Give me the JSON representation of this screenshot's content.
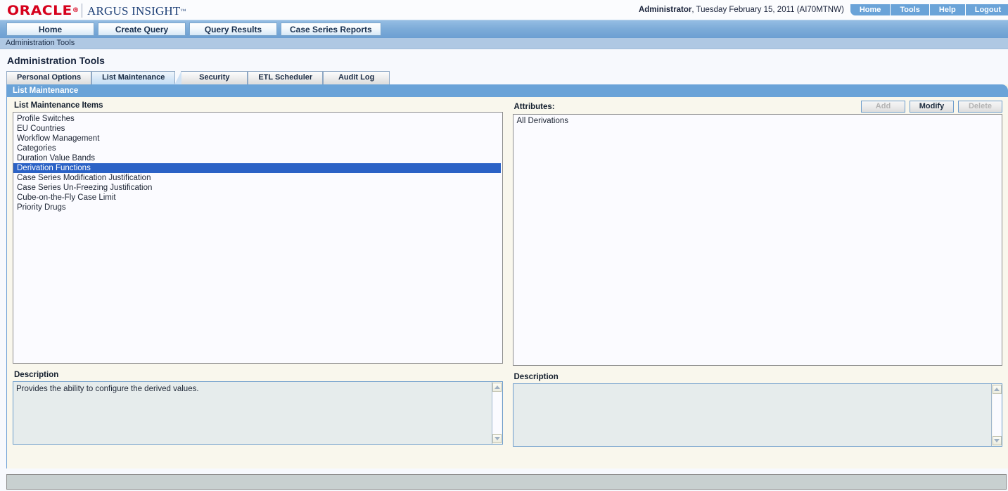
{
  "brand": {
    "oracle": "ORACLE",
    "oracle_reg": "®",
    "product": "ARGUS INSIGHT",
    "product_tm": "™",
    "logo_color": "#d6001c",
    "product_color": "#1d3f76"
  },
  "header": {
    "user_role": "Administrator",
    "session_info": ", Tuesday February 15, 2011 (AI70MTNW)",
    "nav_buttons": [
      {
        "label": "Home"
      },
      {
        "label": "Tools"
      },
      {
        "label": "Help"
      },
      {
        "label": "Logout"
      }
    ]
  },
  "menu_tabs": [
    {
      "label": "Home"
    },
    {
      "label": "Create Query"
    },
    {
      "label": "Query Results"
    },
    {
      "label": "Case Series Reports"
    }
  ],
  "breadcrumb": "Administration Tools",
  "page_title": "Administration Tools",
  "sub_tabs": [
    {
      "label": "Personal Options",
      "active": false
    },
    {
      "label": "List Maintenance",
      "active": true
    },
    {
      "label": "Security",
      "active": false
    },
    {
      "label": "ETL Scheduler",
      "active": false
    },
    {
      "label": "Audit Log",
      "active": false
    }
  ],
  "panel": {
    "header": "List Maintenance",
    "left": {
      "label": "List Maintenance Items",
      "items": [
        {
          "label": "Profile Switches",
          "selected": false
        },
        {
          "label": "EU Countries",
          "selected": false
        },
        {
          "label": "Workflow Management",
          "selected": false
        },
        {
          "label": "Categories",
          "selected": false
        },
        {
          "label": "Duration Value Bands",
          "selected": false
        },
        {
          "label": "Derivation Functions",
          "selected": true
        },
        {
          "label": "Case Series Modification Justification",
          "selected": false
        },
        {
          "label": "Case Series Un-Freezing Justification",
          "selected": false
        },
        {
          "label": "Cube-on-the-Fly Case Limit",
          "selected": false
        },
        {
          "label": "Priority Drugs",
          "selected": false
        }
      ],
      "description_label": "Description",
      "description_value": "Provides the ability to configure the derived values."
    },
    "right": {
      "label": "Attributes:",
      "buttons": [
        {
          "label": "Add",
          "disabled": true
        },
        {
          "label": "Modify",
          "disabled": false
        },
        {
          "label": "Delete",
          "disabled": true
        }
      ],
      "items": [
        {
          "label": "All Derivations",
          "selected": false
        }
      ],
      "description_label": "Description",
      "description_value": ""
    }
  },
  "colors": {
    "accent_blue": "#6aa3d8",
    "selection_blue": "#2b62c6",
    "panel_cream": "#f9f7ed"
  }
}
